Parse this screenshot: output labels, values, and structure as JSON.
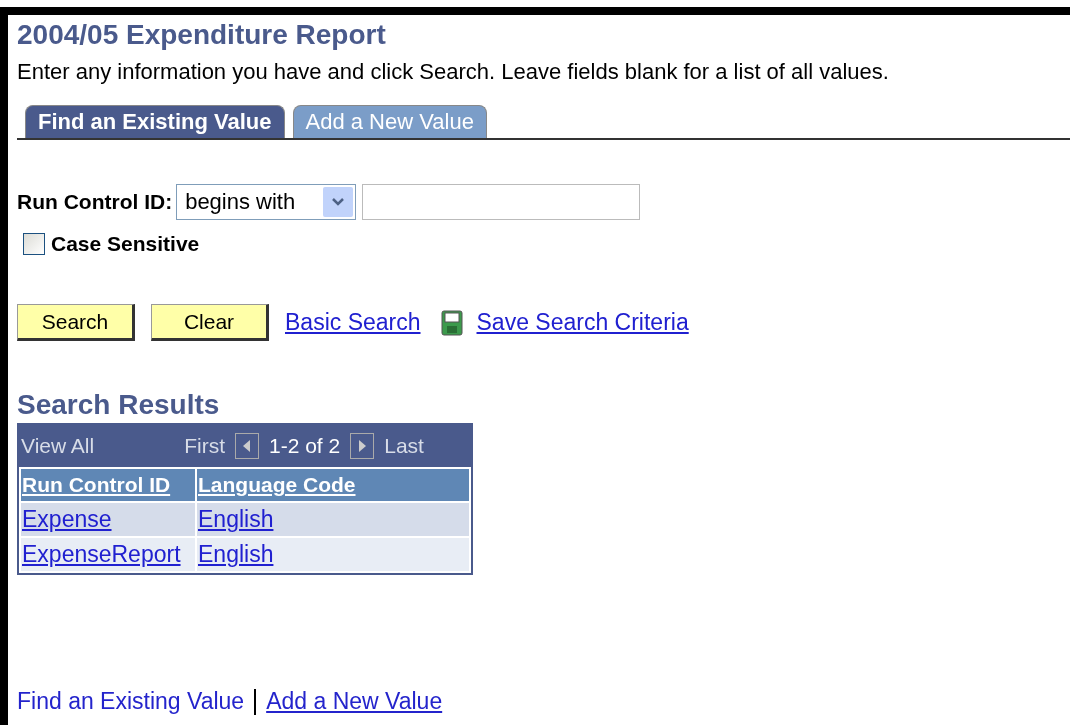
{
  "title": "2004/05 Expenditure Report",
  "instructions": "Enter any information you have and click Search. Leave fields blank for a list of all values.",
  "tabs": [
    {
      "label": "Find an Existing Value",
      "selected": true
    },
    {
      "label": "Add a New Value",
      "selected": false
    }
  ],
  "criteria": {
    "label": "Run Control ID:",
    "operator": "begins with",
    "case_sensitive": {
      "label": "Case Sensitive",
      "checked": false
    }
  },
  "buttons": [
    "Search",
    "Clear"
  ],
  "links": [
    {
      "label": "Basic Search",
      "kind": "link"
    },
    {
      "label": "Save Search Criteria",
      "kind": "save"
    }
  ],
  "results": {
    "title": "Search Results",
    "view_all": "View All",
    "first": "First",
    "range": "1-2 of 2",
    "last": "Last",
    "columns": [
      "Run Control ID",
      "Language Code"
    ],
    "rows": [
      [
        "Expense",
        "English"
      ],
      [
        "ExpenseReport",
        "English"
      ]
    ]
  },
  "footer_links": [
    {
      "label": "Find an Existing Value",
      "selected": true
    },
    {
      "label": "Add a New Value",
      "selected": false
    }
  ]
}
